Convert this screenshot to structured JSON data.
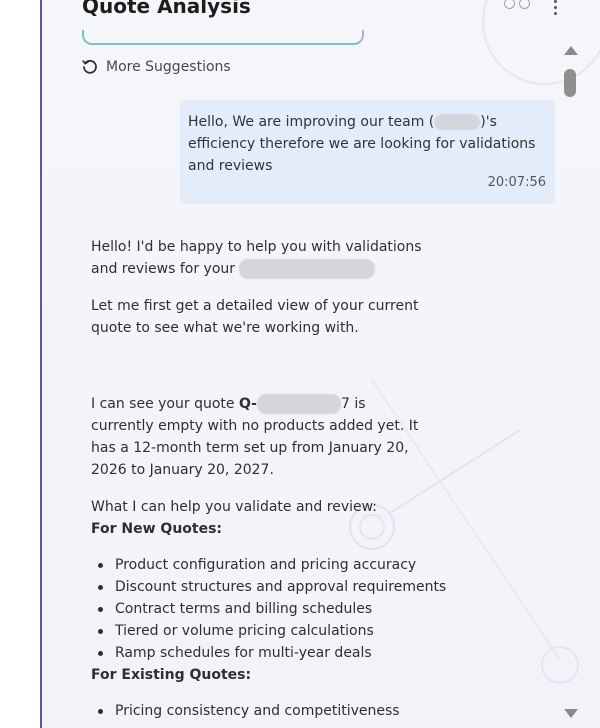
{
  "header": {
    "title": "Quote Analysis"
  },
  "suggestions": {
    "more_label": "More Suggestions"
  },
  "user_message": {
    "text_before": "Hello, We are improving our team (",
    "text_after": ")'s efficiency therefore we are looking for validations and reviews",
    "timestamp": "20:07:56"
  },
  "assistant_message": {
    "greeting_before": "Hello! I'd be happy to help you with validations and reviews for your",
    "intro": "Let me first get a detailed view of your current quote to see what we're working with.",
    "quote_prefix": "I can see your quote ",
    "quote_id_prefix": "Q-",
    "quote_id_suffix": "7",
    "quote_after": " is currently empty with no products added yet. It has a 12-month term set up from January 20, 2026 to January 20, 2027.",
    "help_intro": "What I can help you validate and review:",
    "new_quotes_heading": "For New Quotes:",
    "new_quotes_items": [
      "Product configuration and pricing accuracy",
      "Discount structures and approval requirements",
      "Contract terms and billing schedules",
      "Tiered or volume pricing calculations",
      "Ramp schedules for multi-year deals"
    ],
    "existing_quotes_heading": "For Existing Quotes:",
    "existing_quotes_items": [
      "Pricing consistency and competitiveness"
    ]
  }
}
